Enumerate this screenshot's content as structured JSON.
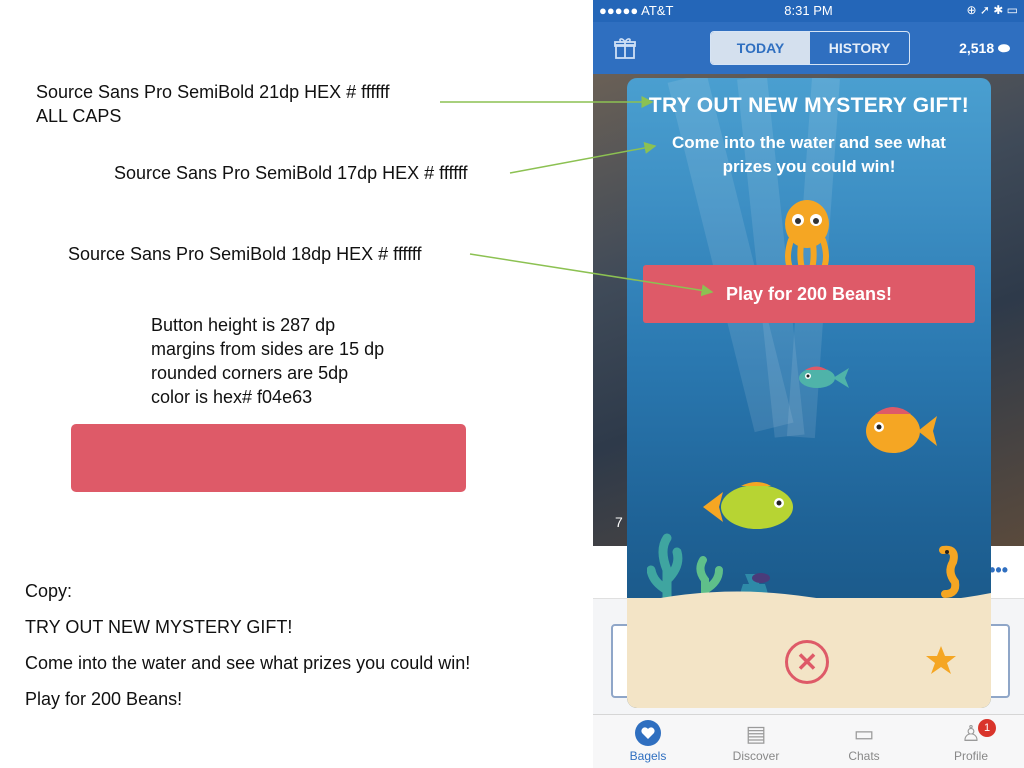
{
  "annotations": {
    "title_spec": [
      "Source Sans Pro SemiBold 21dp HEX # ffffff",
      "ALL CAPS"
    ],
    "subtitle_spec": "Source Sans Pro SemiBold 17dp HEX # ffffff",
    "button_text_spec": "Source Sans Pro SemiBold 18dp HEX # ffffff",
    "button_spec": [
      "Button height is 287 dp",
      "margins from sides are 15 dp",
      "rounded corners are 5dp",
      "color is hex# f04e63"
    ]
  },
  "copy": {
    "heading": "Copy:",
    "lines": [
      "TRY OUT NEW MYSTERY GIFT!",
      "Come into the water and see what prizes you could win!",
      "Play for 200 Beans!"
    ]
  },
  "phone": {
    "status": {
      "carrier": "●●●●● AT&T",
      "time": "8:31 PM",
      "right": "⊕ ➚ ✱ ▭"
    },
    "nav": {
      "tab_today": "TODAY",
      "tab_history": "HISTORY",
      "beans_count": "2,518"
    },
    "photo_number": "7",
    "tabs": [
      "Bagels",
      "Discover",
      "Chats",
      "Profile"
    ],
    "profile_badge": "1",
    "modal": {
      "title": "TRY OUT NEW MYSTERY GIFT!",
      "subtitle": "Come into the water and see what prizes you could win!",
      "button": "Play for 200 Beans!",
      "close": "✕"
    }
  },
  "colors": {
    "accent_red": "#de5a68",
    "nav_blue": "#2f6fc0",
    "arrow_green": "#8cc152"
  }
}
